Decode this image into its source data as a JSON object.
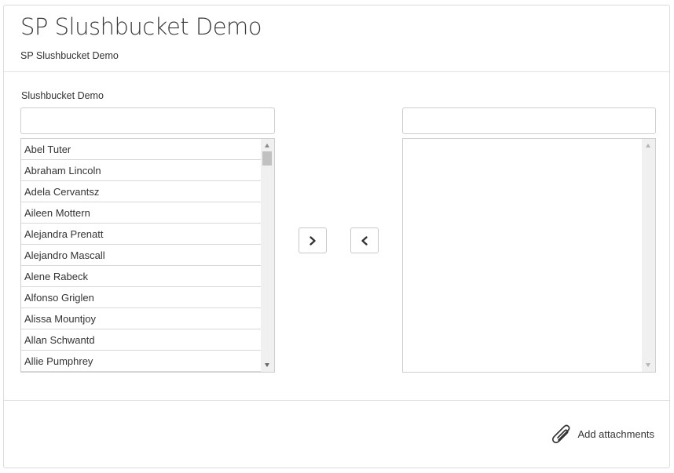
{
  "header": {
    "title": "SP Slushbucket Demo",
    "subtitle": "SP Slushbucket Demo"
  },
  "field": {
    "label": "Slushbucket Demo"
  },
  "available": {
    "search_value": "",
    "items": [
      "Abel Tuter",
      "Abraham Lincoln",
      "Adela Cervantsz",
      "Aileen Mottern",
      "Alejandra Prenatt",
      "Alejandro Mascall",
      "Alene Rabeck",
      "Alfonso Griglen",
      "Alissa Mountjoy",
      "Allan Schwantd",
      "Allie Pumphrey"
    ]
  },
  "selected": {
    "search_value": "",
    "items": []
  },
  "buttons": {
    "add_icon": "chevron-right-icon",
    "remove_icon": "chevron-left-icon"
  },
  "footer": {
    "attach_label": "Add attachments",
    "attach_icon": "paperclip-icon"
  }
}
